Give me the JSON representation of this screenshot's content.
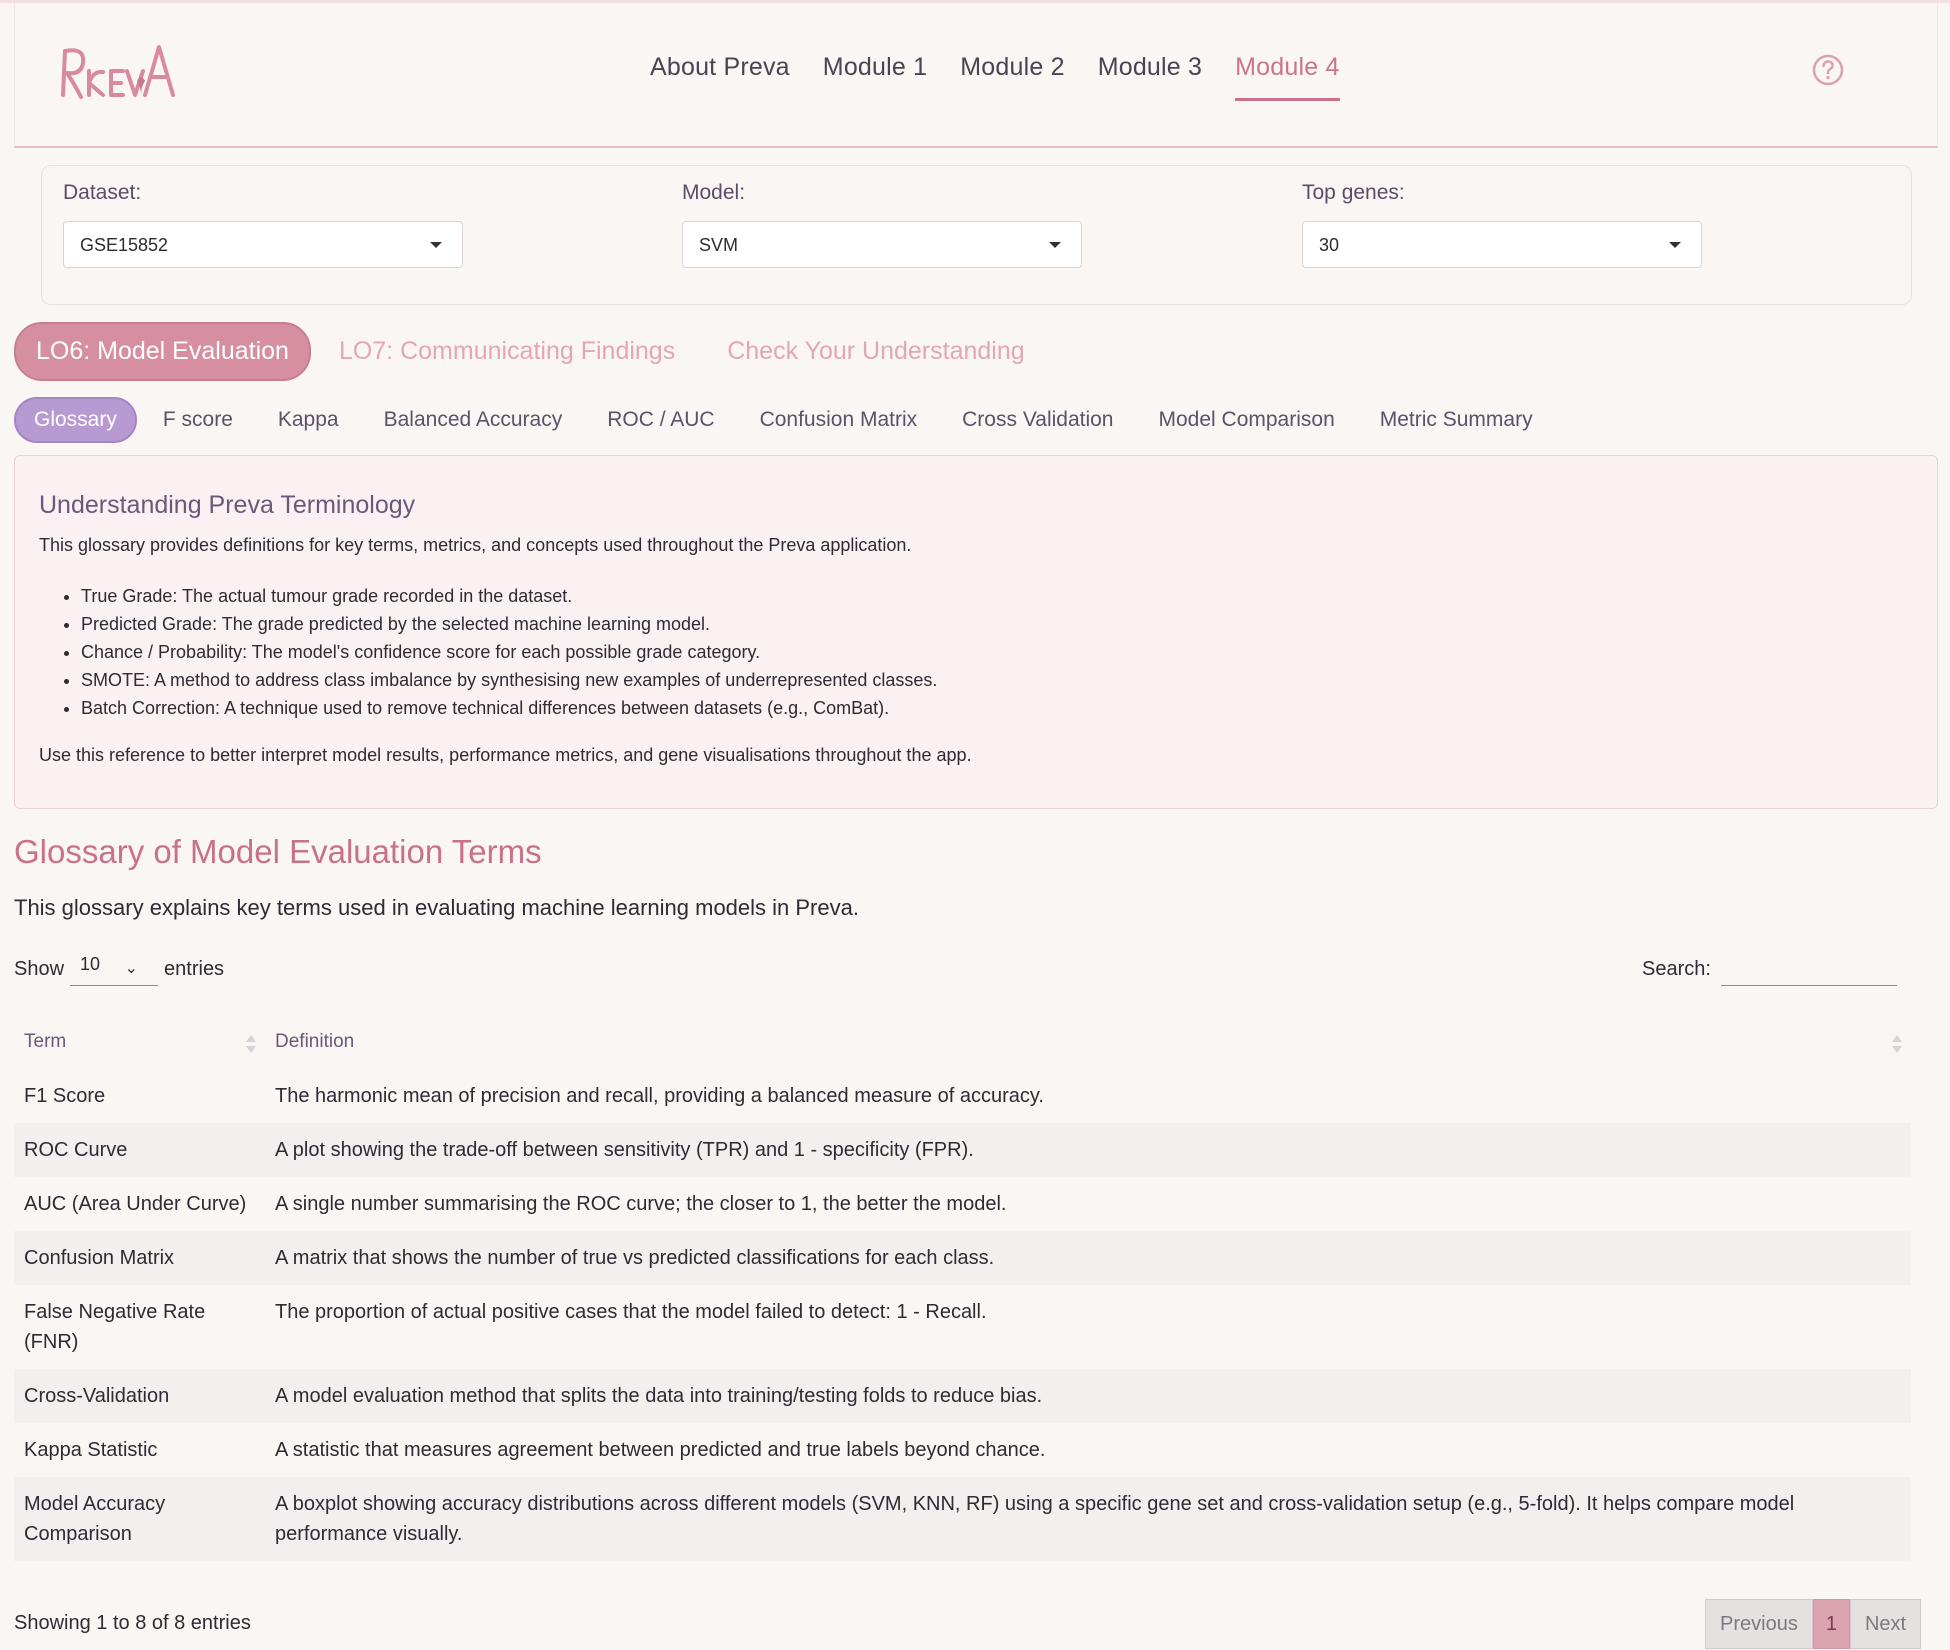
{
  "header": {
    "logo_text": "PrevA",
    "nav": [
      "About Preva",
      "Module 1",
      "Module 2",
      "Module 3",
      "Module 4"
    ],
    "active_nav": "Module 4"
  },
  "filters": {
    "dataset": {
      "label": "Dataset:",
      "value": "GSE15852"
    },
    "model": {
      "label": "Model:",
      "value": "SVM"
    },
    "top_genes": {
      "label": "Top genes:",
      "value": "30"
    }
  },
  "lo_tabs": [
    "LO6: Model Evaluation",
    "LO7: Communicating Findings",
    "Check Your Understanding"
  ],
  "sub_tabs": [
    "Glossary",
    "F score",
    "Kappa",
    "Balanced Accuracy",
    "ROC / AUC",
    "Confusion Matrix",
    "Cross Validation",
    "Model Comparison",
    "Metric Summary"
  ],
  "info": {
    "title": "Understanding Preva Terminology",
    "intro": "This glossary provides definitions for key terms, metrics, and concepts used throughout the Preva application.",
    "items": [
      "True Grade: The actual tumour grade recorded in the dataset.",
      "Predicted Grade: The grade predicted by the selected machine learning model.",
      "Chance / Probability: The model's confidence score for each possible grade category.",
      "SMOTE: A method to address class imbalance by synthesising new examples of underrepresented classes.",
      "Batch Correction: A technique used to remove technical differences between datasets (e.g., ComBat)."
    ],
    "outro": "Use this reference to better interpret model results, performance metrics, and gene visualisations throughout the app."
  },
  "glossary": {
    "title": "Glossary of Model Evaluation Terms",
    "description": "This glossary explains key terms used in evaluating machine learning models in Preva.",
    "show_label": "Show",
    "entries_value": "10",
    "entries_label": "entries",
    "search_label": "Search:",
    "search_value": "",
    "columns": [
      "Term",
      "Definition"
    ],
    "rows": [
      [
        "F1 Score",
        "The harmonic mean of precision and recall, providing a balanced measure of accuracy."
      ],
      [
        "ROC Curve",
        "A plot showing the trade-off between sensitivity (TPR) and 1 - specificity (FPR)."
      ],
      [
        "AUC (Area Under Curve)",
        "A single number summarising the ROC curve; the closer to 1, the better the model."
      ],
      [
        "Confusion Matrix",
        "A matrix that shows the number of true vs predicted classifications for each class."
      ],
      [
        "False Negative Rate (FNR)",
        "The proportion of actual positive cases that the model failed to detect: 1 - Recall."
      ],
      [
        "Cross-Validation",
        "A model evaluation method that splits the data into training/testing folds to reduce bias."
      ],
      [
        "Kappa Statistic",
        "A statistic that measures agreement between predicted and true labels beyond chance."
      ],
      [
        "Model Accuracy Comparison",
        "A boxplot showing accuracy distributions across different models (SVM, KNN, RF) using a specific gene set and cross-validation setup (e.g., 5-fold). It helps compare model performance visually."
      ]
    ],
    "info": "Showing 1 to 8 of 8 entries",
    "pagination": {
      "previous": "Previous",
      "current": "1",
      "next": "Next"
    }
  },
  "colors": {
    "accent": "#c9708b",
    "tab_purple": "#b89ad3",
    "lo_pink": "#d58fa1"
  }
}
